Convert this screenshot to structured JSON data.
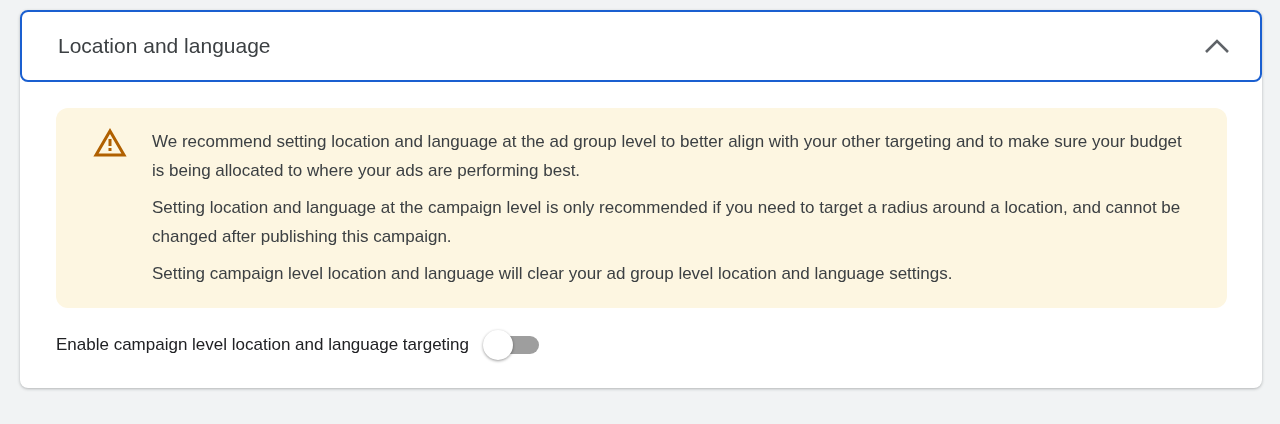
{
  "section": {
    "title": "Location and language",
    "expanded": true
  },
  "notice": {
    "paragraphs": [
      "We recommend setting location and language at the ad group level to better align with your other targeting and to make sure your budget is being allocated to where your ads are performing best.",
      "Setting location and language at the campaign level is only recommended if you need to target a radius around a location, and cannot be changed after publishing this campaign.",
      "Setting campaign level location and language will clear your ad group level location and language settings."
    ]
  },
  "toggle": {
    "label": "Enable campaign level location and language targeting",
    "on": false
  }
}
